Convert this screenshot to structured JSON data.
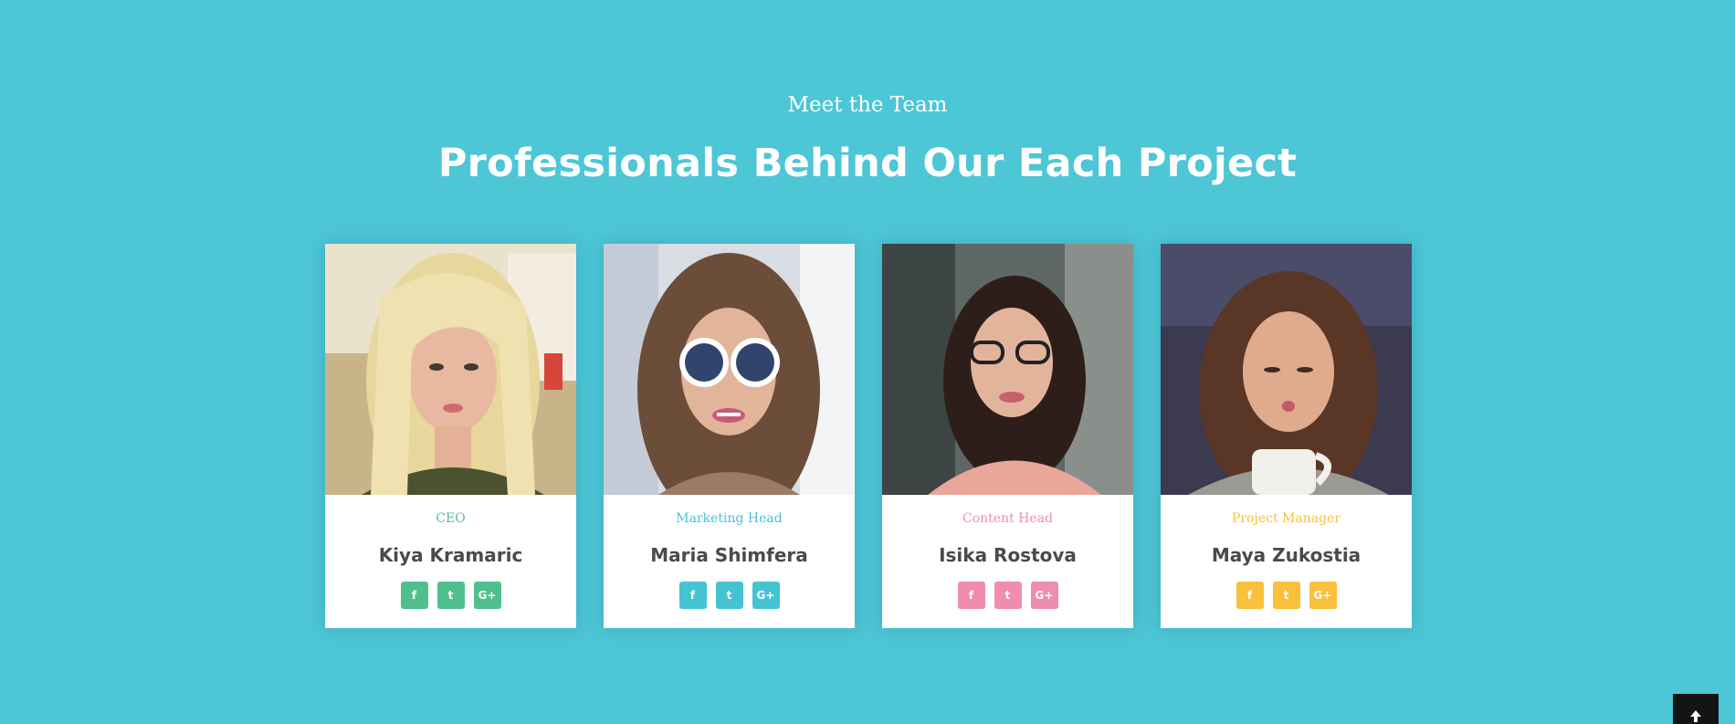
{
  "section": {
    "eyebrow": "Meet the Team",
    "title": "Professionals Behind Our Each Project"
  },
  "members": [
    {
      "role": "CEO",
      "name": "Kiya Kramaric",
      "accent": "#4fc08d",
      "social": [
        "f",
        "t",
        "G+"
      ],
      "photo_alt": "portrait of Kiya Kramaric"
    },
    {
      "role": "Marketing Head",
      "name": "Maria Shimfera",
      "accent": "#45c3d2",
      "social": [
        "f",
        "t",
        "G+"
      ],
      "photo_alt": "portrait of Maria Shimfera"
    },
    {
      "role": "Content Head",
      "name": "Isika Rostova",
      "accent": "#f08cb0",
      "social": [
        "f",
        "t",
        "G+"
      ],
      "photo_alt": "portrait of Isika Rostova"
    },
    {
      "role": "Project Manager",
      "name": "Maya Zukostia",
      "accent": "#f9c03c",
      "social": [
        "f",
        "t",
        "G+"
      ],
      "photo_alt": "portrait of Maya Zukostia"
    }
  ],
  "colors": {
    "background": "#4dc6d6",
    "name_text": "#4a4a4a",
    "back_to_top": "#141414"
  },
  "icons": {
    "facebook": "facebook-icon",
    "twitter": "twitter-icon",
    "google_plus": "google-plus-icon",
    "back_to_top": "arrow-up-icon"
  }
}
